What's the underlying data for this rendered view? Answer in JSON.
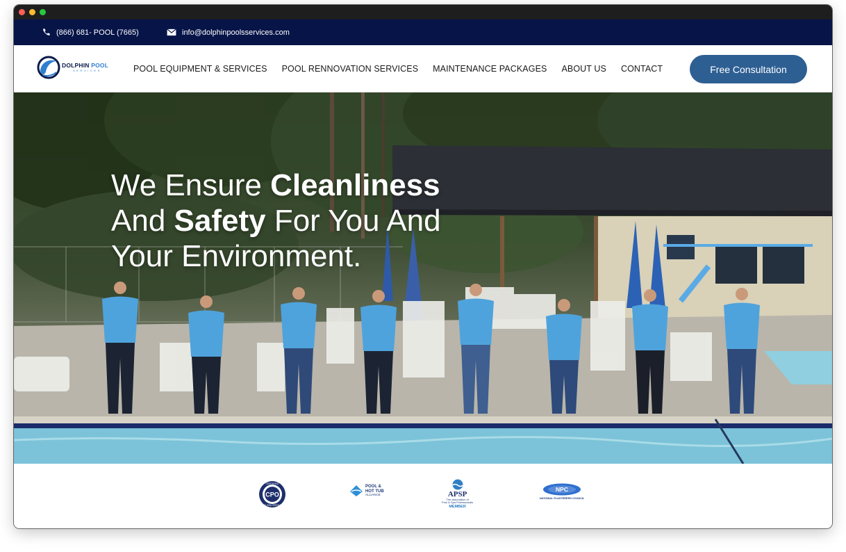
{
  "topbar": {
    "phone": "(866) 681- POOL (7665)",
    "email": "info@dolphinpoolsservices.com",
    "phone_icon": "phone-icon",
    "email_icon": "envelope-icon"
  },
  "logo": {
    "line1a": "DOLPHIN",
    "line1b": "POOL",
    "line2": "SERVICES"
  },
  "nav": {
    "items": [
      {
        "label": "POOL EQUIPMENT & SERVICES"
      },
      {
        "label": "POOL RENNOVATION SERVICES"
      },
      {
        "label": "MAINTENANCE PACKAGES"
      },
      {
        "label": "ABOUT US"
      },
      {
        "label": "CONTACT"
      }
    ],
    "cta": "Free Consultation"
  },
  "hero": {
    "line1_a": "We Ensure ",
    "line1_b": "Cleanliness",
    "line2_a": "And ",
    "line2_b": "Safety",
    "line2_c": " For You And",
    "line3": "Your Environment."
  },
  "badges": [
    {
      "name": "cpo",
      "top": "CERTIFIED",
      "mid": "CPO",
      "bottom": "POOL/SPA OPERATOR"
    },
    {
      "name": "phta",
      "line1": "POOL &",
      "line2": "HOT TUB",
      "line3": "ALLIANCE"
    },
    {
      "name": "apsp",
      "line1": "APSP",
      "line2": "The association of",
      "line3": "Pool & Spa Professionals",
      "line4": "MEMBER"
    },
    {
      "name": "npc",
      "line1": "NPC",
      "line2": "NATIONAL PLASTERERS COUNCIL"
    }
  ],
  "colors": {
    "topbar": "#071448",
    "cta": "#2e5f93",
    "shirt": "#4fa3dc",
    "pool_water": "#7cc3d9"
  }
}
